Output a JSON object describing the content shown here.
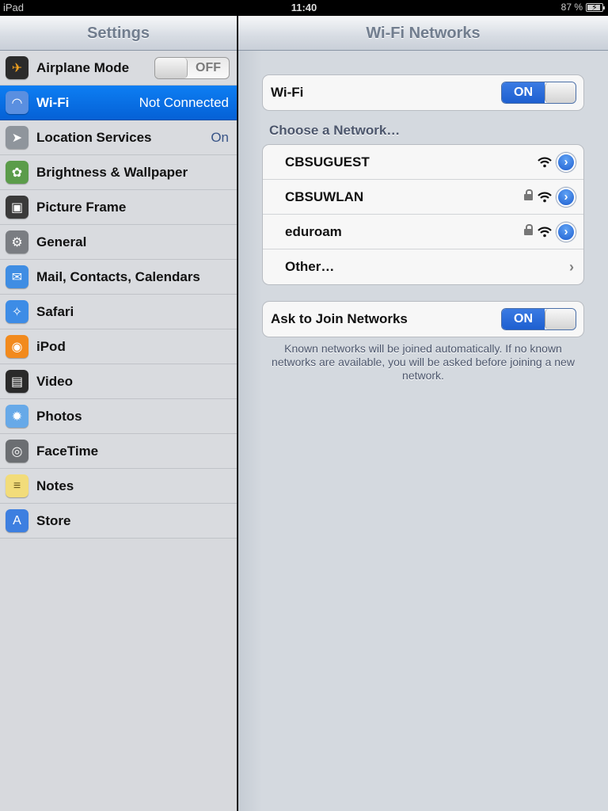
{
  "status_bar": {
    "carrier": "iPad",
    "time": "11:40",
    "battery": "87 %",
    "battery_level_percent": 87
  },
  "master": {
    "title": "Settings",
    "items": [
      {
        "label": "Airplane Mode",
        "icon": "airplane-icon",
        "color": "#2b2b2b",
        "toggle": "OFF"
      },
      {
        "label": "Wi-Fi",
        "icon": "wifi-icon",
        "color": "#5a8fe0",
        "value": "Not Connected",
        "selected": true
      },
      {
        "label": "Location Services",
        "icon": "location-arrow-icon",
        "color": "#8f959c",
        "value": "On"
      },
      {
        "label": "Brightness & Wallpaper",
        "icon": "flower-icon",
        "color": "#5b9c4a"
      },
      {
        "label": "Picture Frame",
        "icon": "picture-frame-icon",
        "color": "#3a3a3a"
      },
      {
        "label": "General",
        "icon": "gear-icon",
        "color": "#7a7d82"
      },
      {
        "label": "Mail, Contacts, Calendars",
        "icon": "mail-icon",
        "color": "#3f8de3"
      },
      {
        "label": "Safari",
        "icon": "compass-icon",
        "color": "#3d8ce6"
      },
      {
        "label": "iPod",
        "icon": "ipod-icon",
        "color": "#f28a1d"
      },
      {
        "label": "Video",
        "icon": "clapperboard-icon",
        "color": "#2a2a2a"
      },
      {
        "label": "Photos",
        "icon": "sunflower-icon",
        "color": "#67a9e8"
      },
      {
        "label": "FaceTime",
        "icon": "camera-icon",
        "color": "#6b6e72"
      },
      {
        "label": "Notes",
        "icon": "notepad-icon",
        "color": "#f2dc7a"
      },
      {
        "label": "Store",
        "icon": "app-store-icon",
        "color": "#3d7fe0"
      }
    ]
  },
  "detail": {
    "title": "Wi-Fi Networks",
    "wifi_label": "Wi-Fi",
    "wifi_toggle": "ON",
    "choose_header": "Choose a Network…",
    "networks": [
      {
        "name": "CBSUGUEST",
        "locked": false
      },
      {
        "name": "CBSUWLAN",
        "locked": true
      },
      {
        "name": "eduroam",
        "locked": true
      }
    ],
    "other_label": "Other…",
    "ask_label": "Ask to Join Networks",
    "ask_toggle": "ON",
    "footnote": "Known networks will be joined automatically.  If no known networks are available, you will be asked before joining a new network."
  },
  "colors": {
    "selection_blue": "#0a6fe6",
    "switch_on_blue": "#2a6cd9",
    "disclosure_blue": "#2d6fd8"
  }
}
